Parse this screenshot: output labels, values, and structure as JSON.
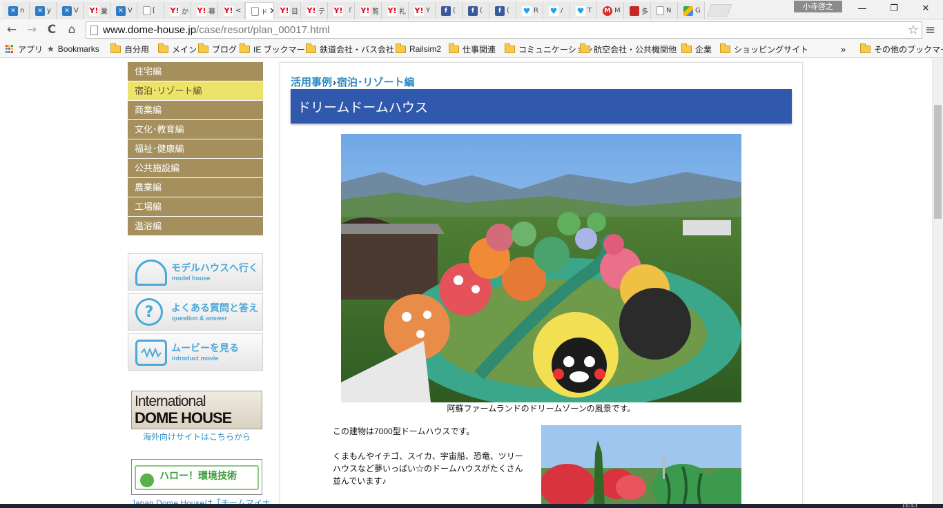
{
  "browser": {
    "tabs": [
      {
        "label": "n",
        "icon": "x"
      },
      {
        "label": "y",
        "icon": "x"
      },
      {
        "label": "V",
        "icon": "x"
      },
      {
        "label": "業",
        "icon": "y"
      },
      {
        "label": "V",
        "icon": "x"
      },
      {
        "label": "[",
        "icon": "doc"
      },
      {
        "label": "か",
        "icon": "y"
      },
      {
        "label": "幕",
        "icon": "y"
      },
      {
        "label": "<",
        "icon": "y"
      },
      {
        "label": "ド",
        "icon": "doc",
        "active": true
      },
      {
        "label": "目",
        "icon": "y"
      },
      {
        "label": "テ",
        "icon": "y"
      },
      {
        "label": "「",
        "icon": "y"
      },
      {
        "label": "覧",
        "icon": "y"
      },
      {
        "label": "礼",
        "icon": "y"
      },
      {
        "label": "Y",
        "icon": "y"
      },
      {
        "label": "(",
        "icon": "fb"
      },
      {
        "label": "(",
        "icon": "fb"
      },
      {
        "label": "(",
        "icon": "fb"
      },
      {
        "label": "R",
        "icon": "tw"
      },
      {
        "label": "/",
        "icon": "tw"
      },
      {
        "label": "T",
        "icon": "tw"
      },
      {
        "label": "M",
        "icon": "m"
      },
      {
        "label": "多",
        "icon": "sq"
      },
      {
        "label": "N",
        "icon": "doc"
      },
      {
        "label": "G",
        "icon": "map"
      }
    ],
    "tab_close_glyph": "✕",
    "user_name": "小寺啓之",
    "window_controls": {
      "minimize": "—",
      "restore": "❐",
      "close": "✕"
    },
    "nav": {
      "back": "←",
      "forward": "→",
      "reload": "C",
      "home": "⌂"
    },
    "url": {
      "host": "www.dome-house.jp",
      "path": "/case/resort/plan_00017.html"
    },
    "star_glyph": "☆",
    "menu_glyph": "≡",
    "bookmarks": [
      {
        "label": "アプリ",
        "type": "apps"
      },
      {
        "label": "Bookmarks",
        "type": "star"
      },
      {
        "label": "自分用",
        "type": "folder"
      },
      {
        "label": "メイン",
        "type": "folder"
      },
      {
        "label": "ブログ",
        "type": "folder"
      },
      {
        "label": "IE ブックマーク",
        "type": "folder"
      },
      {
        "label": "鉄道会社・バス会社",
        "type": "folder"
      },
      {
        "label": "Railsim2",
        "type": "folder"
      },
      {
        "label": "仕事関連",
        "type": "folder"
      },
      {
        "label": "コミュニケーション",
        "type": "folder"
      },
      {
        "label": "航空会社・公共機関他",
        "type": "folder"
      },
      {
        "label": "企業",
        "type": "folder"
      },
      {
        "label": "ショッピングサイト",
        "type": "folder"
      }
    ],
    "bookmarks_overflow": "»",
    "other_bookmarks": "その他のブックマーク"
  },
  "sidebar": {
    "categories": [
      "住宅編",
      "宿泊･リゾート編",
      "商業編",
      "文化･教育編",
      "福祉･健康編",
      "公共施設編",
      "農業編",
      "工場編",
      "温浴編"
    ],
    "current_index": 1,
    "buttons": [
      {
        "title": "モデルハウスへ行く",
        "subtitle": "model house"
      },
      {
        "title": "よくある質問と答え",
        "subtitle": "question & answer",
        "icon_glyph": "?"
      },
      {
        "title": "ムービーを見る",
        "subtitle": "introduct movie"
      }
    ],
    "international_banner": {
      "line1": "International",
      "line2": "DOME HOUSE"
    },
    "international_link": "海外向けサイトはこちらから",
    "hello_banner": {
      "title": "ハロー！環境技術"
    },
    "hello_link": "Japan Dome Houseは「チームマイナ"
  },
  "main": {
    "breadcrumb": {
      "parent": "活用事例",
      "separator": "›",
      "current": "宿泊･リゾート編"
    },
    "title": "ドリームドームハウス",
    "caption": "阿蘇ファームランドのドリームゾーンの風景です。",
    "paragraphs": [
      "この建物は7000型ドームハウスです。",
      "くまもんやイチゴ、スイカ、宇宙船、恐竜、ツリーハウスなど夢いっぱい☆のドームハウスがたくさん並んでいます♪"
    ]
  },
  "colors": {
    "nav_bg": "#a58f5d",
    "nav_current_bg": "#ede36a",
    "title_bar": "#3059ad",
    "link": "#2f8bc2"
  },
  "taskbar": {
    "clock": "16:43"
  }
}
